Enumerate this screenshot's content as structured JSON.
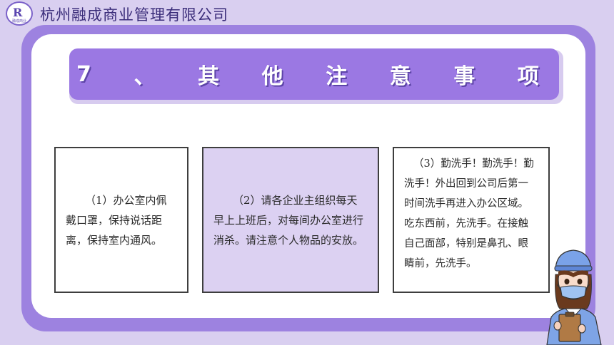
{
  "header": {
    "logo_letters": "R",
    "logo_sub": "融成商业",
    "company_name": "杭州融成商业管理有限公司"
  },
  "slide": {
    "title_chars": [
      "7",
      "、",
      "其",
      "他",
      "注",
      "意",
      "事",
      "项"
    ]
  },
  "notes": [
    {
      "text": "（1）办公室内佩戴口罩，保持说话距离，保持室内通风。"
    },
    {
      "text": "（2）请各企业主组织每天早上上班后，对每间办公室进行消杀。请注意个人物品的安放。"
    },
    {
      "text": "（3）勤洗手！勤洗手！勤洗手！外出回到公司后第一时间洗手再进入办公区域。吃东西前，先洗手。在接触自己面部，特别是鼻孔、眼睛前，先洗手。"
    }
  ],
  "colors": {
    "page_bg": "#d9cff0",
    "frame": "#9d82e0",
    "title_bar": "#9b78e3",
    "note2_bg": "#dcd1f2"
  },
  "icons": {
    "logo": "company-logo-icon",
    "character": "masked-worker-illustration"
  }
}
